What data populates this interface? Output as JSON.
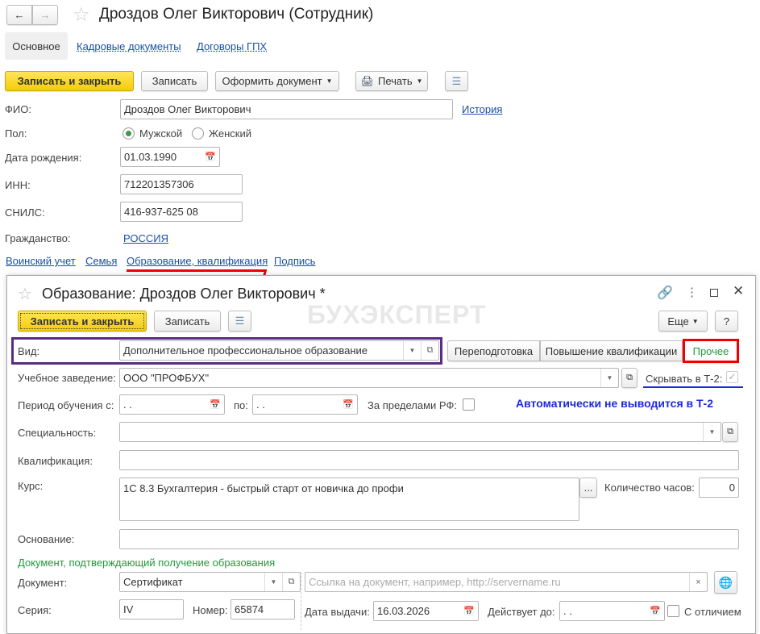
{
  "window": {
    "title": "Дроздов Олег Викторович (Сотрудник)",
    "tabs": [
      "Основное",
      "Кадровые документы",
      "Договоры ГПХ"
    ],
    "toolbar": {
      "save_close": "Записать и закрыть",
      "save": "Записать",
      "make_doc": "Оформить документ",
      "print": "Печать"
    },
    "form": {
      "fio_label": "ФИО:",
      "fio": "Дроздов Олег Викторович",
      "history": "История",
      "sex_label": "Пол:",
      "male": "Мужской",
      "female": "Женский",
      "birth_label": "Дата рождения:",
      "birth": "01.03.1990",
      "inn_label": "ИНН:",
      "inn": "712201357306",
      "snils_label": "СНИЛС:",
      "snils": "416-937-625 08",
      "citizen_label": "Гражданство:",
      "citizen": "РОССИЯ"
    },
    "links": [
      "Воинский учет",
      "Семья",
      "Образование, квалификация",
      "Подпись"
    ]
  },
  "dialog": {
    "title": "Образование: Дроздов Олег Викторович *",
    "watermark": "БУХЭКСПЕРТ",
    "toolbar": {
      "save_close": "Записать и закрыть",
      "save": "Записать",
      "more": "Еще",
      "help": "?"
    },
    "vid_label": "Вид:",
    "vid": "Дополнительное профессиональное образование",
    "vid_buttons": [
      "Переподготовка",
      "Повышение квалификации",
      "Прочее"
    ],
    "school_label": "Учебное заведение:",
    "school": "ООО \"ПРОФБУХ\"",
    "hide_t2_label": "Скрывать в Т-2:",
    "hide_t2": true,
    "period_label": "Период обучения с:",
    "period_from": " .  .",
    "to_label": "по:",
    "period_to": " .  .",
    "abroad_label": "За пределами РФ:",
    "note": "Автоматически не выводится в Т-2",
    "specialty_label": "Специальность:",
    "qualification_label": "Квалификация:",
    "course_label": "Курс:",
    "course": "1С 8.3 Бухгалтерия - быстрый старт от новичка до профи",
    "course_btn": "...",
    "hours_label": "Количество часов:",
    "hours": "0",
    "basis_label": "Основание:",
    "doc_section": "Документ, подтверждающий получение образования",
    "doc_label": "Документ:",
    "doc": "Сертификат",
    "link_placeholder": "Ссылка на документ, например, http://servername.ru",
    "series_label": "Серия:",
    "series": "IV",
    "number_label": "Номер:",
    "number": "65874",
    "issue_label": "Дата выдачи:",
    "issue": "16.03.2026",
    "valid_label": "Действует до:",
    "valid": " .  .",
    "honors_label": "С отличием"
  }
}
